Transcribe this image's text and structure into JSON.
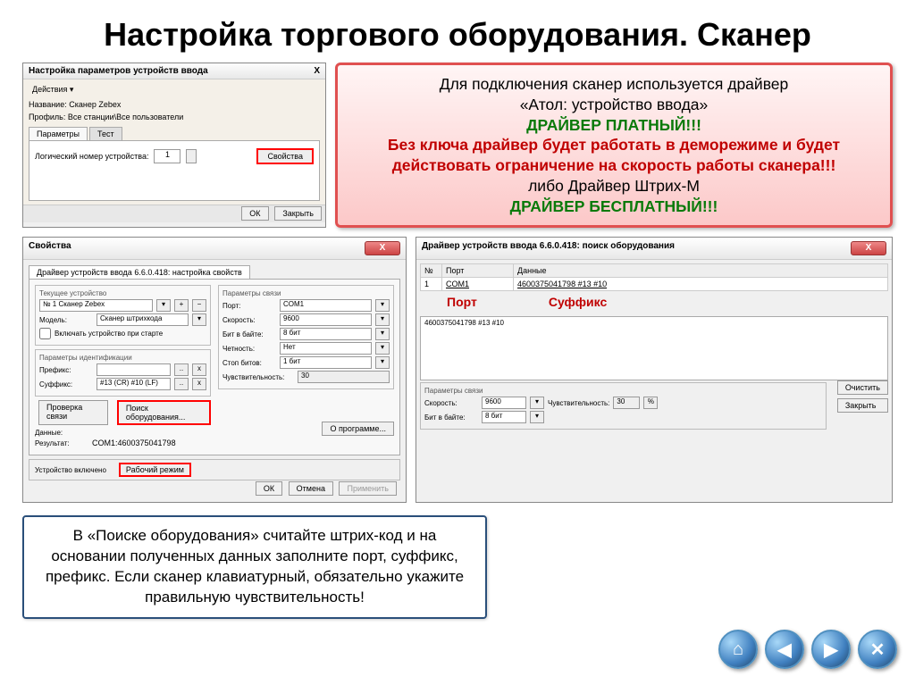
{
  "title": "Настройка торгового оборудования. Сканер",
  "dialog1": {
    "title": "Настройка параметров устройств ввода",
    "actions": "Действия ▾",
    "name_label": "Название:",
    "name_value": "Сканер Zebex",
    "profile_label": "Профиль:",
    "profile_value": "Все станции\\Все пользователи",
    "tab_params": "Параметры",
    "tab_test": "Тест",
    "logical_num": "Логический номер устройства:",
    "num_value": "1",
    "props_btn": "Свойства",
    "ok": "ОК",
    "close": "Закрыть"
  },
  "info": {
    "l1": "Для подключения сканер используется драйвер",
    "l2": "«Атол: устройство ввода»",
    "l3": "ДРАЙВЕР ПЛАТНЫЙ!!!",
    "l4": "Без ключа драйвер будет работать в деморежиме и будет действовать ограничение на скорость работы сканера!!!",
    "l5": "либо Драйвер Штрих-М",
    "l6": "ДРАЙВЕР БЕСПЛАТНЫЙ!!!"
  },
  "dialog2": {
    "wintitle": "Свойства",
    "tab": "Драйвер устройств ввода 6.6.0.418: настройка свойств",
    "current_device": "Текущее устройство",
    "device_no": "№ 1 Сканер Zebex",
    "model_label": "Модель:",
    "model_value": "Сканер штрихкода",
    "check_on_start": "Включать устройство при старте",
    "ident_params": "Параметры идентификации",
    "prefix_label": "Префикс:",
    "prefix_value": "",
    "suffix_label": "Суффикс:",
    "suffix_value": "#13 (CR) #10 (LF)",
    "conn_params": "Параметры связи",
    "port_label": "Порт:",
    "port_value": "COM1",
    "speed_label": "Скорость:",
    "speed_value": "9600",
    "bits_label": "Бит в байте:",
    "bits_value": "8 бит",
    "parity_label": "Четность:",
    "parity_value": "Нет",
    "stopbits_label": "Стоп битов:",
    "stopbits_value": "1 бит",
    "sens_label": "Чувствительность:",
    "sens_value": "30",
    "btn_check": "Проверка связи",
    "btn_search": "Поиск оборудования...",
    "btn_about": "О программе...",
    "data_label": "Данные:",
    "result_label": "Результат:",
    "result_value": "COM1:4600375041798",
    "dev_on": "Устройство включено",
    "workmode": "Рабочий режим",
    "ok": "ОК",
    "cancel": "Отмена",
    "apply": "Применить"
  },
  "dialog3": {
    "title": "Драйвер устройств ввода 6.6.0.418: поиск оборудования",
    "col_n": "№",
    "col_port": "Порт",
    "col_data": "Данные",
    "row_n": "1",
    "row_port": "COM1",
    "row_data": "4600375041798 #13 #10",
    "ann_port": "Порт",
    "ann_suffix": "Суффикс",
    "list_item": "4600375041798 #13 #10",
    "params": "Параметры связи",
    "speed_label": "Скорость:",
    "speed_value": "9600",
    "sens_label": "Чувствительность:",
    "sens_value": "30",
    "bits_label": "Бит в байте:",
    "bits_value": "8 бит",
    "btn_clear": "Очистить",
    "btn_close": "Закрыть"
  },
  "note": "В «Поиске оборудования» считайте штрих-код и на основании полученных данных заполните порт, суффикс, префикс. Если сканер клавиатурный, обязательно укажите правильную чувствительность!",
  "nav": {
    "home": "⌂",
    "back": "◀",
    "fwd": "▶",
    "close": "✕"
  }
}
